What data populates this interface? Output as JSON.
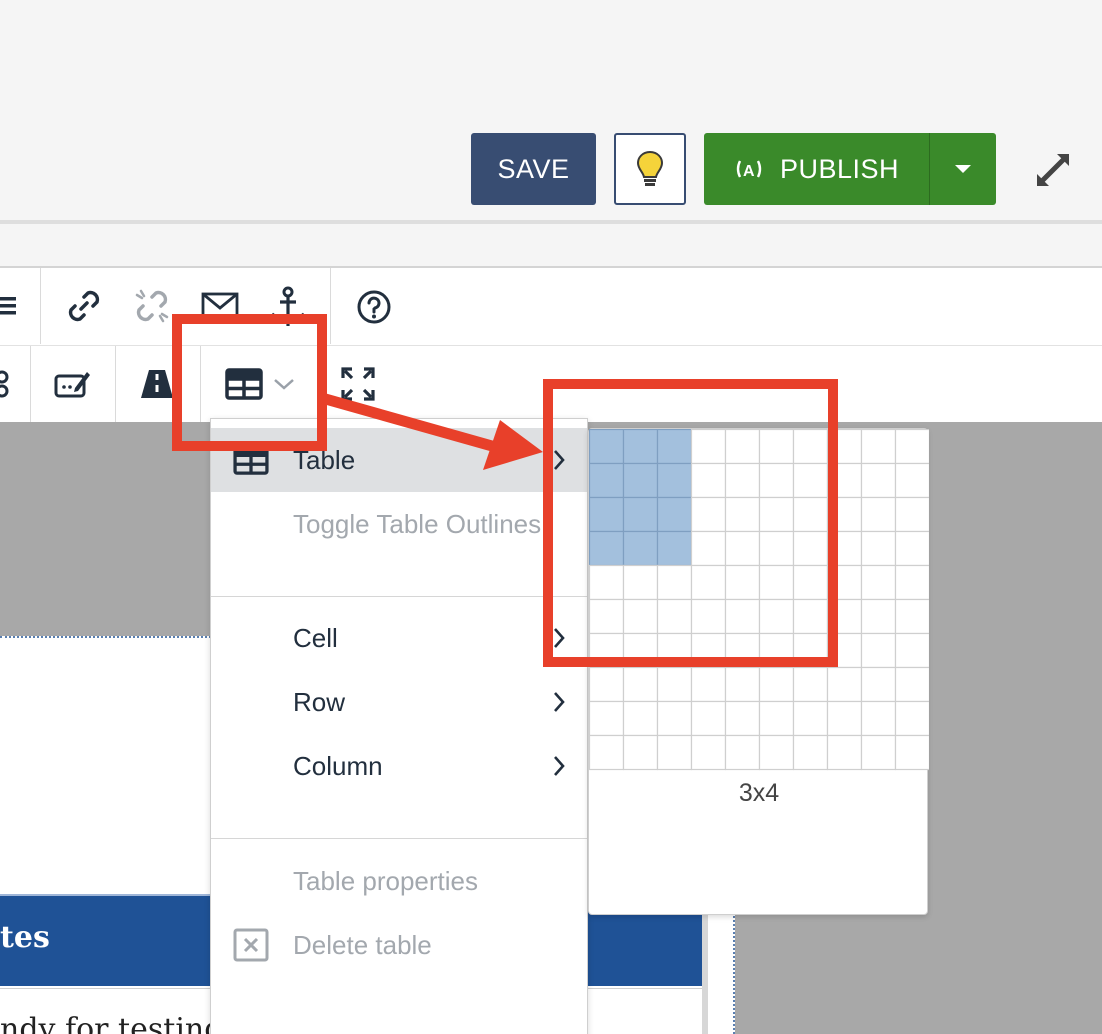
{
  "header": {
    "save_label": "SAVE",
    "publish_label": "PUBLISH",
    "publish_icon": "broadcast-icon",
    "hint_icon": "lightbulb-icon",
    "expand_icon": "expand-arrows-icon"
  },
  "toolbar": {
    "row1_icons": [
      "list-icon",
      "link-icon",
      "unlink-icon",
      "mail-icon",
      "anchor-icon",
      "help-icon"
    ],
    "row2_icons": [
      "layers-icon",
      "edit-field-icon",
      "road-icon",
      "table-icon",
      "fullscreen-icon"
    ]
  },
  "menu": {
    "items": [
      {
        "label": "Table",
        "icon": "table-icon",
        "submenu": true,
        "disabled": false,
        "active": true
      },
      {
        "label": "Toggle Table Outlines",
        "disabled": true
      },
      {
        "label": "Cell",
        "submenu": true,
        "disabled": false
      },
      {
        "label": "Row",
        "submenu": true,
        "disabled": false
      },
      {
        "label": "Column",
        "submenu": true,
        "disabled": false
      },
      {
        "label": "Table properties",
        "disabled": true
      },
      {
        "label": "Delete table",
        "icon": "delete-box-icon",
        "disabled": true
      }
    ]
  },
  "grid_picker": {
    "columns": 10,
    "rows": 10,
    "selected_cols": 3,
    "selected_rows": 4,
    "size_label": "3x4"
  },
  "document": {
    "banner_text": "tes",
    "body_text": "ndy for testing"
  },
  "colors": {
    "save_bg": "#384d72",
    "publish_bg": "#3a8a2a",
    "annotation_red": "#e8402a",
    "grid_selected": "#a3c0dd",
    "banner_bg": "#1f5296"
  }
}
